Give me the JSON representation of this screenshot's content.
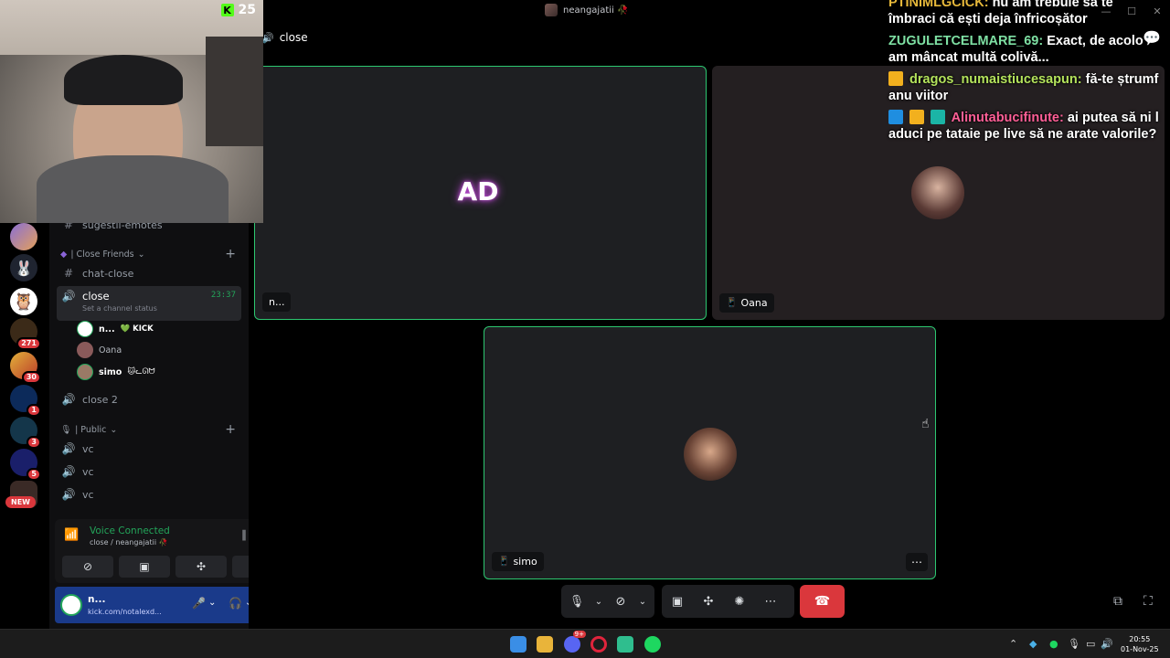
{
  "window": {
    "title": "neangajatii 🥀"
  },
  "webcam": {
    "kick_count": "25"
  },
  "chat": {
    "messages": [
      {
        "user": "PTINIMLGCICK:",
        "text": "nu am trebuie să te îmbraci că ești deja înfricoșător",
        "color": "#e6b83a"
      },
      {
        "user": "ZUGULETCELMARE_69:",
        "text": "Exact, de acolo am mâncat multă colivă...",
        "color": "#7ee0a3"
      },
      {
        "user": "dragos_numaistiucesapun:",
        "text": "fă-te ștrumf anu viitor",
        "color": "#b4e35c"
      },
      {
        "user": "Alinutabucifinute:",
        "text": "ai putea să ni l aduci pe tataie pe live să ne arate valorile?",
        "color": "#ff5f97"
      }
    ]
  },
  "rail": {
    "badges": [
      "271",
      "30",
      "1",
      "3",
      "5"
    ],
    "new_label": "NEW"
  },
  "sidebar": {
    "partial_channel": "sugestii-emotes",
    "category_close_friends": "| Close Friends",
    "chat_close": "chat-close",
    "close_channel": "close",
    "close_timer": "23:37",
    "close_status": "Set a channel status",
    "users": [
      {
        "name": "n...",
        "tag": "💚 KICK"
      },
      {
        "name": "Oana",
        "tag": ""
      },
      {
        "name": "simo",
        "tag": "🐱ᓚᘏᗢ"
      }
    ],
    "close2": "close 2",
    "category_public": "| Public",
    "vc_channels": [
      "vc",
      "vc",
      "vc"
    ]
  },
  "voice": {
    "status": "Voice Connected",
    "location": "close / neangajatii 🥀"
  },
  "userpanel": {
    "name": "n...",
    "status": "kick.com/notalexd..."
  },
  "main": {
    "header_channel": "close",
    "tiles": [
      {
        "name": "n..."
      },
      {
        "name": "Oana"
      },
      {
        "name": "simo"
      }
    ]
  },
  "taskbar": {
    "time": "20:55",
    "date": "01-Nov-25",
    "discord_badge": "9+"
  },
  "colors": {
    "accent_green": "#23a55a",
    "danger_red": "#da373c",
    "blurple": "#5865f2"
  }
}
